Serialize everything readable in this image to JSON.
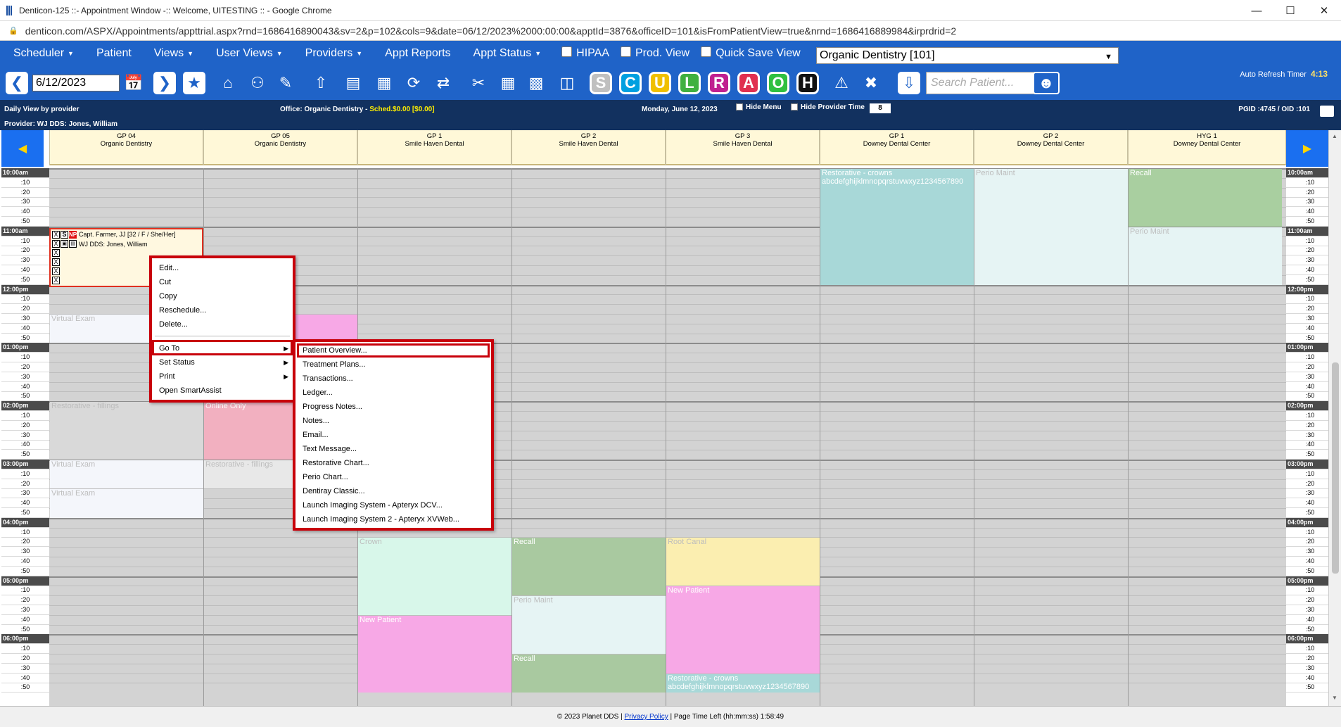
{
  "window": {
    "title": "Denticon-125 ::- Appointment Window -:: Welcome, UITESTING :: - Google Chrome",
    "url": "denticon.com/ASPX/Appointments/appttrial.aspx?rnd=1686416890043&sv=2&p=102&cols=9&date=06/12/2023%2000:00:00&apptId=3876&officeID=101&isFromPatientView=true&nrnd=1686416889984&irprdrid=2"
  },
  "menubar": {
    "scheduler": "Scheduler",
    "patient": "Patient",
    "views": "Views",
    "user_views": "User Views",
    "providers": "Providers",
    "appt_reports": "Appt Reports",
    "appt_status": "Appt Status",
    "hipaa": "HIPAA",
    "prod_view": "Prod. View",
    "quick_save_view": "Quick Save View",
    "office_value": "Organic Dentistry [101]"
  },
  "toolbar": {
    "date_value": "6/12/2023",
    "search_placeholder": "Search Patient...",
    "auto_refresh_label": "Auto Refresh Timer",
    "auto_refresh_value": "4:13",
    "letters": [
      "S",
      "C",
      "U",
      "L",
      "R",
      "A",
      "O",
      "H"
    ],
    "letter_colors": [
      "#c0c0c0",
      "#00a0e0",
      "#f0c000",
      "#40b040",
      "#c02090",
      "#e03050",
      "#30c040",
      "#111111"
    ]
  },
  "infobar": {
    "view_label": "Daily View by provider",
    "office_label": "Office: Organic Dentistry - ",
    "sched_label": "Sched.$0.00 [$0.00]",
    "date_label": "Monday, June 12, 2023",
    "hide_menu": "Hide Menu",
    "hide_provider_time": "Hide Provider Time",
    "zoom_value": "8",
    "ids": "PGID :4745  /  OID :101",
    "provider_label": "Provider: WJ DDS: Jones, William"
  },
  "operatories": [
    {
      "name": "GP 04",
      "office": "Organic Dentistry"
    },
    {
      "name": "GP 05",
      "office": "Organic Dentistry"
    },
    {
      "name": "GP 1",
      "office": "Smile Haven Dental"
    },
    {
      "name": "GP 2",
      "office": "Smile Haven Dental"
    },
    {
      "name": "GP 3",
      "office": "Smile Haven Dental"
    },
    {
      "name": "GP 1",
      "office": "Downey Dental Center"
    },
    {
      "name": "GP 2",
      "office": "Downey Dental Center"
    },
    {
      "name": "HYG 1",
      "office": "Downey Dental Center"
    }
  ],
  "time_labels": {
    "hours": [
      "10:00am",
      "11:00am",
      "12:00pm",
      "01:00pm",
      "02:00pm",
      "03:00pm",
      "04:00pm",
      "05:00pm",
      "06:00pm"
    ],
    "minutes": [
      ":10",
      ":20",
      ":30",
      ":40",
      ":50"
    ]
  },
  "blocks": {
    "restorative_crowns": "Restorative - crowns",
    "restorative_crowns_sub": "abcdefghijklmnopqrstuvwxyz1234567890",
    "perio_maint": "Perio Maint",
    "recall": "Recall",
    "virtual_exam": "Virtual Exam",
    "restorative_fillings": "Restorative - fillings",
    "online_only": "Online Only",
    "crown": "Crown",
    "root_canal": "Root Canal",
    "new_patient": "New Patient"
  },
  "appointment": {
    "patient": "Capt. Farmer, JJ [32 / F / She/Her]",
    "provider": "WJ DDS: Jones, William",
    "x_mark": "X",
    "s_mark": "S",
    "n_mark": "NP"
  },
  "context_menu": {
    "edit": "Edit...",
    "cut": "Cut",
    "copy": "Copy",
    "reschedule": "Reschedule...",
    "delete": "Delete...",
    "goto": "Go To",
    "set_status": "Set Status",
    "print": "Print",
    "open_smartassist": "Open SmartAssist"
  },
  "goto_submenu": [
    "Patient Overview...",
    "Treatment Plans...",
    "Transactions...",
    "Ledger...",
    "Progress Notes...",
    "Notes...",
    "Email...",
    "Text Message...",
    "Restorative Chart...",
    "Perio Chart...",
    "Dentiray Classic...",
    "Launch Imaging System - Apteryx DCV...",
    "Launch Imaging System 2 - Apteryx XVWeb..."
  ],
  "footer": {
    "copyright": "© 2023 Planet DDS | ",
    "privacy": "Privacy Policy",
    "time_left": " |  Page Time Left (hh:mm:ss) 1:58:49"
  },
  "colors": {
    "menu_blue": "#1f63c8",
    "dark_navy": "#12315f",
    "highlight_red": "#c8000a",
    "header_cream": "#fff8d8"
  }
}
